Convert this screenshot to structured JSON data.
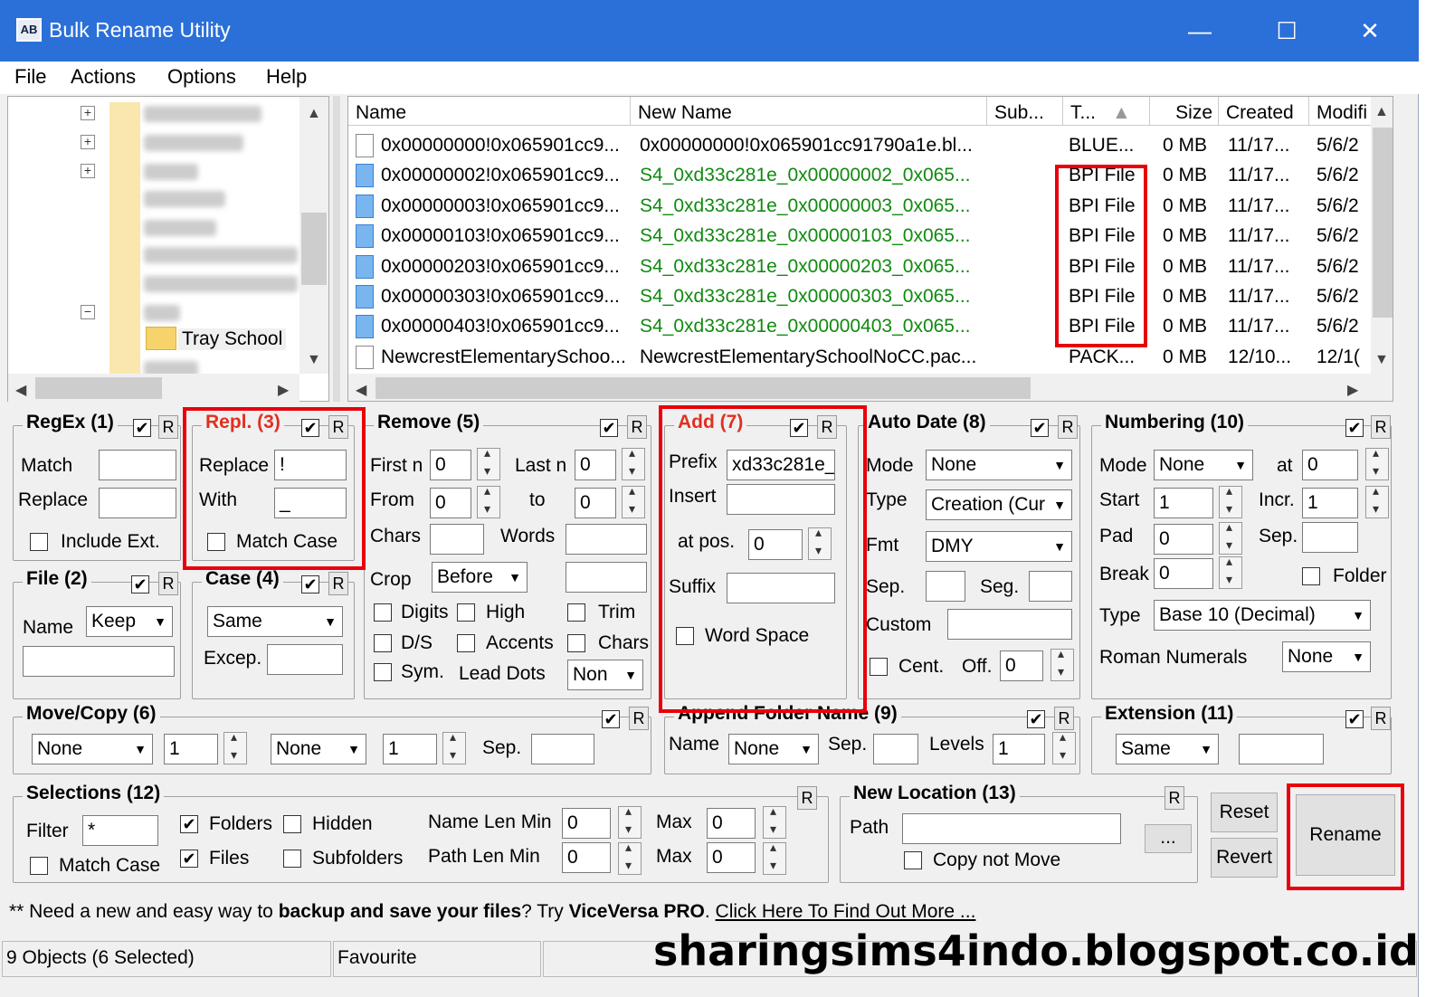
{
  "window": {
    "title": "Bulk Rename Utility",
    "app_icon_text": "AB",
    "minimize": "—",
    "maximize": "☐",
    "close": "✕"
  },
  "menu": [
    "File",
    "Actions",
    "Options",
    "Help"
  ],
  "tree": {
    "selected_folder": "Tray School"
  },
  "file_list": {
    "columns": [
      "Name",
      "New Name",
      "Sub...",
      "T...",
      "Size",
      "Created",
      "Modifi"
    ],
    "rows": [
      {
        "name": "0x00000000!0x065901cc9...",
        "new_name": "0x00000000!0x065901cc91790a1e.bl...",
        "type": "BLUE...",
        "size": "0 MB",
        "created": "11/17...",
        "modified": "5/6/2",
        "selected": false,
        "renamed": false
      },
      {
        "name": "0x00000002!0x065901cc9...",
        "new_name": "S4_0xd33c281e_0x00000002_0x065...",
        "type": "BPI File",
        "size": "0 MB",
        "created": "11/17...",
        "modified": "5/6/2",
        "selected": true,
        "renamed": true
      },
      {
        "name": "0x00000003!0x065901cc9...",
        "new_name": "S4_0xd33c281e_0x00000003_0x065...",
        "type": "BPI File",
        "size": "0 MB",
        "created": "11/17...",
        "modified": "5/6/2",
        "selected": true,
        "renamed": true
      },
      {
        "name": "0x00000103!0x065901cc9...",
        "new_name": "S4_0xd33c281e_0x00000103_0x065...",
        "type": "BPI File",
        "size": "0 MB",
        "created": "11/17...",
        "modified": "5/6/2",
        "selected": true,
        "renamed": true
      },
      {
        "name": "0x00000203!0x065901cc9...",
        "new_name": "S4_0xd33c281e_0x00000203_0x065...",
        "type": "BPI File",
        "size": "0 MB",
        "created": "11/17...",
        "modified": "5/6/2",
        "selected": true,
        "renamed": true
      },
      {
        "name": "0x00000303!0x065901cc9...",
        "new_name": "S4_0xd33c281e_0x00000303_0x065...",
        "type": "BPI File",
        "size": "0 MB",
        "created": "11/17...",
        "modified": "5/6/2",
        "selected": true,
        "renamed": true
      },
      {
        "name": "0x00000403!0x065901cc9...",
        "new_name": "S4_0xd33c281e_0x00000403_0x065...",
        "type": "BPI File",
        "size": "0 MB",
        "created": "11/17...",
        "modified": "5/6/2",
        "selected": true,
        "renamed": true
      },
      {
        "name": "NewcrestElementarySchoo...",
        "new_name": "NewcrestElementarySchoolNoCC.pac...",
        "type": "PACK...",
        "size": "0 MB",
        "created": "12/10...",
        "modified": "12/1(",
        "selected": false,
        "renamed": false
      }
    ]
  },
  "regex": {
    "title": "RegEx (1)",
    "match_label": "Match",
    "replace_label": "Replace",
    "include_ext": "Include Ext.",
    "r": "R"
  },
  "repl": {
    "title": "Repl. (3)",
    "replace_label": "Replace",
    "replace_value": "!",
    "with_label": "With",
    "with_value": "_",
    "match_case": "Match Case",
    "r": "R"
  },
  "remove": {
    "title": "Remove (5)",
    "first_n": "First n",
    "first_n_value": "0",
    "last_n": "Last n",
    "last_n_value": "0",
    "from": "From",
    "from_value": "0",
    "to": "to",
    "to_value": "0",
    "chars": "Chars",
    "words": "Words",
    "crop": "Crop",
    "crop_value": "Before",
    "digits": "Digits",
    "high": "High",
    "trim": "Trim",
    "ds": "D/S",
    "accents": "Accents",
    "chars2": "Chars",
    "sym": "Sym.",
    "lead_dots": "Lead Dots",
    "lead_dots_value": "Non",
    "r": "R"
  },
  "add": {
    "title": "Add (7)",
    "prefix": "Prefix",
    "prefix_value": "xd33c281e_",
    "insert": "Insert",
    "at_pos": "at pos.",
    "at_pos_value": "0",
    "suffix": "Suffix",
    "word_space": "Word Space",
    "r": "R"
  },
  "auto_date": {
    "title": "Auto Date (8)",
    "mode": "Mode",
    "mode_value": "None",
    "type": "Type",
    "type_value": "Creation (Cur",
    "fmt": "Fmt",
    "fmt_value": "DMY",
    "sep": "Sep.",
    "seg": "Seg.",
    "custom": "Custom",
    "cent": "Cent.",
    "off": "Off.",
    "off_value": "0",
    "r": "R"
  },
  "numbering": {
    "title": "Numbering (10)",
    "mode": "Mode",
    "mode_value": "None",
    "at": "at",
    "at_value": "0",
    "start": "Start",
    "start_value": "1",
    "incr": "Incr.",
    "incr_value": "1",
    "pad": "Pad",
    "pad_value": "0",
    "sep": "Sep.",
    "break": "Break",
    "break_value": "0",
    "folder": "Folder",
    "type": "Type",
    "type_value": "Base 10 (Decimal)",
    "roman": "Roman Numerals",
    "roman_value": "None",
    "r": "R"
  },
  "file_grp": {
    "title": "File (2)",
    "name": "Name",
    "name_value": "Keep",
    "r": "R"
  },
  "case_grp": {
    "title": "Case (4)",
    "case_value": "Same",
    "excep": "Excep.",
    "r": "R"
  },
  "move_copy": {
    "title": "Move/Copy (6)",
    "dd1": "None",
    "n1": "1",
    "dd2": "None",
    "n2": "1",
    "sep": "Sep.",
    "r": "R"
  },
  "append_folder": {
    "title": "Append Folder Name (9)",
    "name": "Name",
    "name_value": "None",
    "sep": "Sep.",
    "levels": "Levels",
    "levels_value": "1",
    "r": "R"
  },
  "extension": {
    "title": "Extension (11)",
    "value": "Same",
    "r": "R"
  },
  "selections": {
    "title": "Selections (12)",
    "filter": "Filter",
    "filter_value": "*",
    "folders": "Folders",
    "hidden": "Hidden",
    "name_len_min": "Name Len Min",
    "name_len_min_value": "0",
    "max": "Max",
    "max_value": "0",
    "match_case": "Match Case",
    "files": "Files",
    "subfolders": "Subfolders",
    "path_len_min": "Path Len Min",
    "path_len_min_value": "0",
    "max2_value": "0",
    "r": "R"
  },
  "new_location": {
    "title": "New Location (13)",
    "path": "Path",
    "browse": "...",
    "copy_not_move": "Copy not Move",
    "r": "R"
  },
  "buttons": {
    "reset": "Reset",
    "revert": "Revert",
    "rename": "Rename"
  },
  "promo": {
    "prefix": "** Need a new and easy way to ",
    "bold": "backup and save your files",
    "mid": "? Try ",
    "product": "ViceVersa PRO",
    "dot": ". ",
    "link": "Click Here To Find Out More ..."
  },
  "status": {
    "objects": "9 Objects (6 Selected)",
    "favourite": "Favourite"
  },
  "watermark": "sharingsims4indo.blogspot.co.id",
  "checks": "✔",
  "colors": {
    "titlebar": "#2b70d8",
    "highlight": "#e8000a",
    "renamed_text": "#108a10"
  }
}
